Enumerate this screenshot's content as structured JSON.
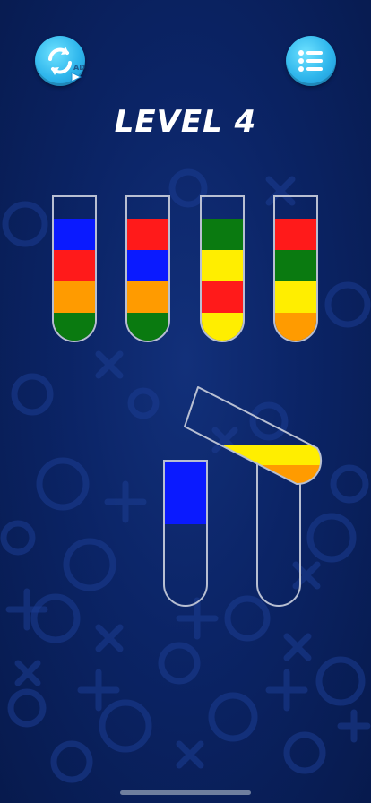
{
  "header": {
    "level_title": "LEVEL 4",
    "restart_button_icon": "restart-ad-icon",
    "restart_ad_badge": "AD",
    "menu_button_icon": "list-menu-icon"
  },
  "colors": {
    "blue": "#0a1aff",
    "red": "#ff1a1a",
    "orange": "#ff9b00",
    "green": "#0a7a10",
    "yellow": "#ffee00"
  },
  "tubes": [
    {
      "id": 1,
      "layers_top_to_bottom": [
        "blue",
        "red",
        "orange",
        "green"
      ]
    },
    {
      "id": 2,
      "layers_top_to_bottom": [
        "red",
        "blue",
        "orange",
        "green"
      ]
    },
    {
      "id": 3,
      "layers_top_to_bottom": [
        "green",
        "yellow",
        "red",
        "yellow"
      ]
    },
    {
      "id": 4,
      "layers_top_to_bottom": [
        "red",
        "green",
        "yellow",
        "orange"
      ]
    },
    {
      "id": 5,
      "layers_top_to_bottom": [
        "blue"
      ]
    },
    {
      "id": 6,
      "layers_top_to_bottom": []
    },
    {
      "id": 7,
      "state": "pouring",
      "layers_top_to_bottom": [
        "yellow",
        "orange"
      ]
    }
  ]
}
